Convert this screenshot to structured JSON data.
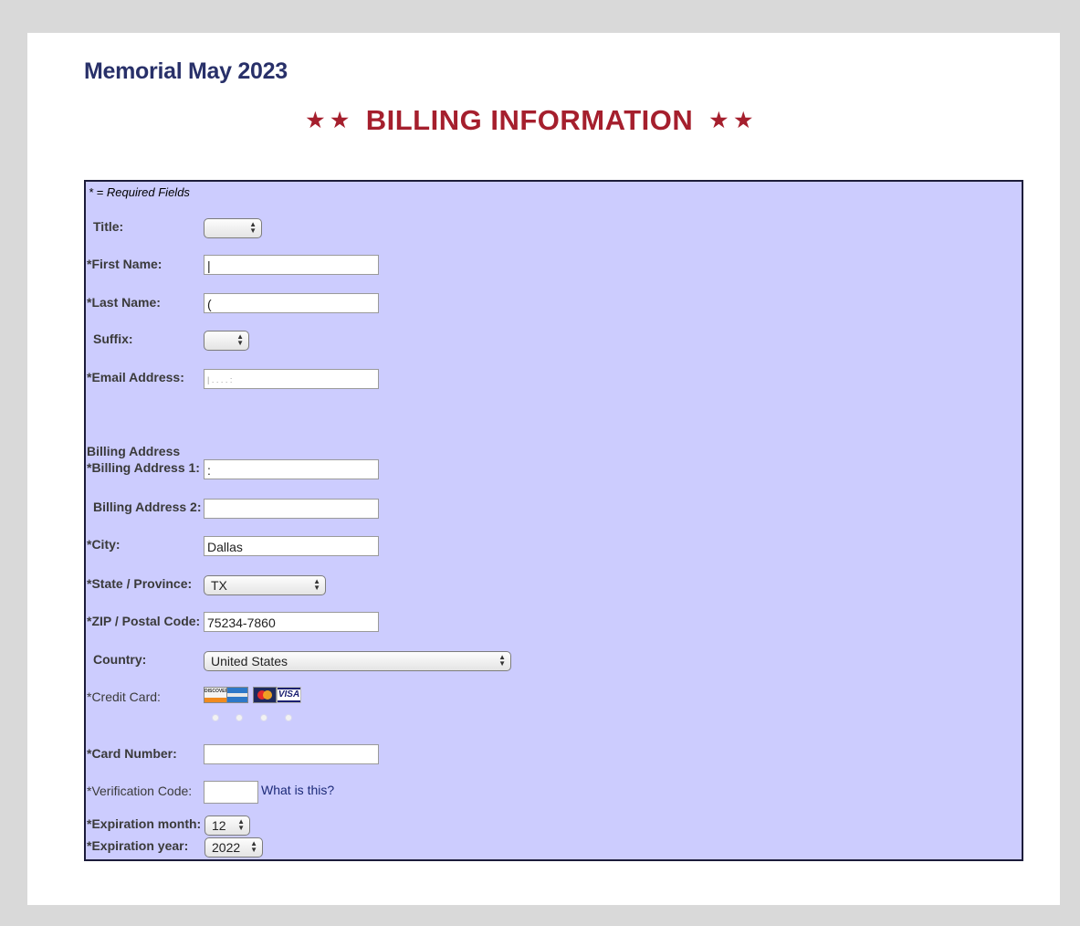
{
  "event_title": "Memorial May 2023",
  "billing_heading": {
    "stars_left": "★ ★",
    "text": "BILLING INFORMATION",
    "stars_right": "★ ★"
  },
  "required_note": "* = Required Fields",
  "fields": {
    "title": {
      "label": "Title:",
      "value": ""
    },
    "first_name": {
      "label": "*First Name:",
      "value": "|"
    },
    "last_name": {
      "label": "*Last Name:",
      "value": "("
    },
    "suffix": {
      "label": "Suffix:",
      "value": ""
    },
    "email": {
      "label": "*Email Address:",
      "value": "|   .   .            .   .   :"
    },
    "billing_section": "Billing Address",
    "address1": {
      "label": "*Billing Address 1:",
      "value": ":"
    },
    "address2": {
      "label": "Billing Address 2:",
      "value": ""
    },
    "city": {
      "label": "*City:",
      "value": "Dallas"
    },
    "state": {
      "label": "*State / Province:",
      "value": "TX"
    },
    "zip": {
      "label": "*ZIP / Postal Code:",
      "value": "75234-7860"
    },
    "country": {
      "label": "Country:",
      "value": "United States"
    },
    "credit_card": {
      "label": "*Credit Card:",
      "types": [
        "discover-icon",
        "amex-icon",
        "mastercard-icon",
        "visa-icon"
      ],
      "discover_text": "DISCOVER",
      "visa_text": "VISA"
    },
    "card_number": {
      "label": "*Card Number:",
      "value": ""
    },
    "verification": {
      "label": "*Verification Code:",
      "value": "",
      "help_link": "What is this?"
    },
    "exp_month": {
      "label": "*Expiration month:",
      "value": "12"
    },
    "exp_year": {
      "label": "*Expiration year:",
      "value": "2022"
    }
  },
  "colors": {
    "page_bg": "#d9d9d9",
    "title": "#283069",
    "heading": "#a51f2d",
    "form_bg": "#ccccfe"
  }
}
